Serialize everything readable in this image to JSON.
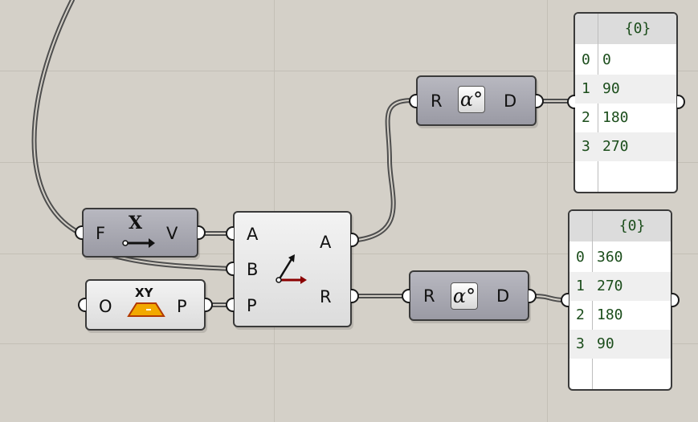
{
  "nodes": {
    "deconstruct_vector": {
      "input_label": "F",
      "output_label": "V",
      "icon_text": "X"
    },
    "xy_plane": {
      "input_label": "O",
      "output_label": "P",
      "icon_text": "XY"
    },
    "angle": {
      "inputs": [
        "A",
        "B",
        "P"
      ],
      "outputs": [
        "A",
        "R"
      ]
    },
    "degrees_top": {
      "input_label": "R",
      "output_label": "D",
      "icon_text": "α°"
    },
    "degrees_bottom": {
      "input_label": "R",
      "output_label": "D",
      "icon_text": "α°"
    }
  },
  "panels": {
    "top": {
      "header": "{0}",
      "rows": [
        {
          "index": "0",
          "value": "0"
        },
        {
          "index": "1",
          "value": "90"
        },
        {
          "index": "2",
          "value": "180"
        },
        {
          "index": "3",
          "value": "270"
        }
      ]
    },
    "bottom": {
      "header": "{0}",
      "rows": [
        {
          "index": "0",
          "value": "360"
        },
        {
          "index": "1",
          "value": "270"
        },
        {
          "index": "2",
          "value": "180"
        },
        {
          "index": "3",
          "value": "90"
        }
      ]
    }
  },
  "colors": {
    "canvas": "#d4d0c8",
    "grid": "#c3bfb6",
    "wire": "#5a5a5a",
    "node_dark": "#a8a8b0",
    "node_light": "#e8e8e8",
    "panel_text": "#1b4d1b",
    "angle_arrow": "#8b0000",
    "plane_icon": "#f2a900"
  },
  "icons": {
    "deconstruct_vector": "vector-arrow-icon",
    "xy_plane": "xy-plane-icon",
    "angle": "angle-icon",
    "degrees": "degrees-icon"
  }
}
